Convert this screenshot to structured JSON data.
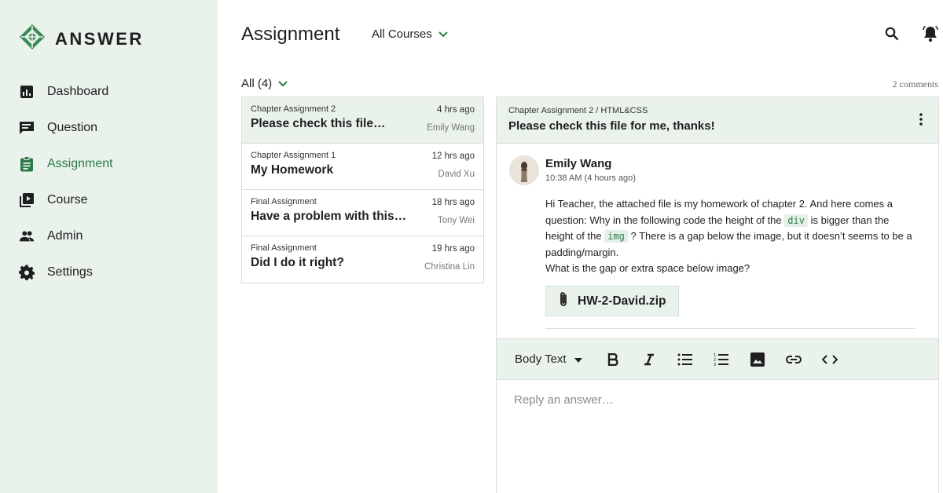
{
  "app": {
    "name": "ANSWER"
  },
  "sidebar": {
    "items": [
      {
        "label": "Dashboard",
        "icon": "dashboard-icon"
      },
      {
        "label": "Question",
        "icon": "question-icon"
      },
      {
        "label": "Assignment",
        "icon": "assignment-icon",
        "active": true
      },
      {
        "label": "Course",
        "icon": "course-icon"
      },
      {
        "label": "Admin",
        "icon": "admin-icon"
      },
      {
        "label": "Settings",
        "icon": "settings-icon"
      }
    ]
  },
  "header": {
    "title": "Assignment",
    "course_filter": "All Courses",
    "icons": [
      "search-icon",
      "bell-icon"
    ]
  },
  "list": {
    "filter_label": "All (4)",
    "comments_count": "2 comments",
    "items": [
      {
        "chapter": "Chapter Assignment 2",
        "title": "Please check this file…",
        "time": "4 hrs ago",
        "author": "Emily Wang",
        "active": true
      },
      {
        "chapter": "Chapter Assignment 1",
        "title": "My Homework",
        "time": "12 hrs ago",
        "author": "David Xu"
      },
      {
        "chapter": "Final Assignment",
        "title": "Have a problem with this…",
        "time": "18 hrs ago",
        "author": "Tony Wei"
      },
      {
        "chapter": "Final Assignment",
        "title": "Did I do it right?",
        "time": "19 hrs ago",
        "author": "Christina Lin"
      }
    ]
  },
  "detail": {
    "breadcrumb": "Chapter Assignment 2 / HTML&CSS",
    "title": "Please check this file for me, thanks!",
    "message": {
      "author": "Emily Wang",
      "time": "10:38 AM (4 hours ago)",
      "body_1": "Hi Teacher, the attached file is my homework of chapter 2. And here comes a question: Why in the following code the height of the",
      "code_1": "div",
      "body_2": "is bigger than the height of the",
      "code_2": "img",
      "body_3": "? There is a gap below the image, but it doesn’t seems to be a padding/margin.",
      "body_4": "What is the gap or extra space below image?",
      "attachment": "HW-2-David.zip"
    }
  },
  "editor": {
    "format": "Body Text",
    "tools": [
      "bold-icon",
      "italic-icon",
      "bullet-list-icon",
      "numbered-list-icon",
      "image-icon",
      "link-icon",
      "code-icon"
    ],
    "placeholder": "Reply an answer…"
  },
  "colors": {
    "accent": "#2e7a4a",
    "sidebar_bg": "#eaf2ec",
    "code_bg": "#e4efe7"
  }
}
